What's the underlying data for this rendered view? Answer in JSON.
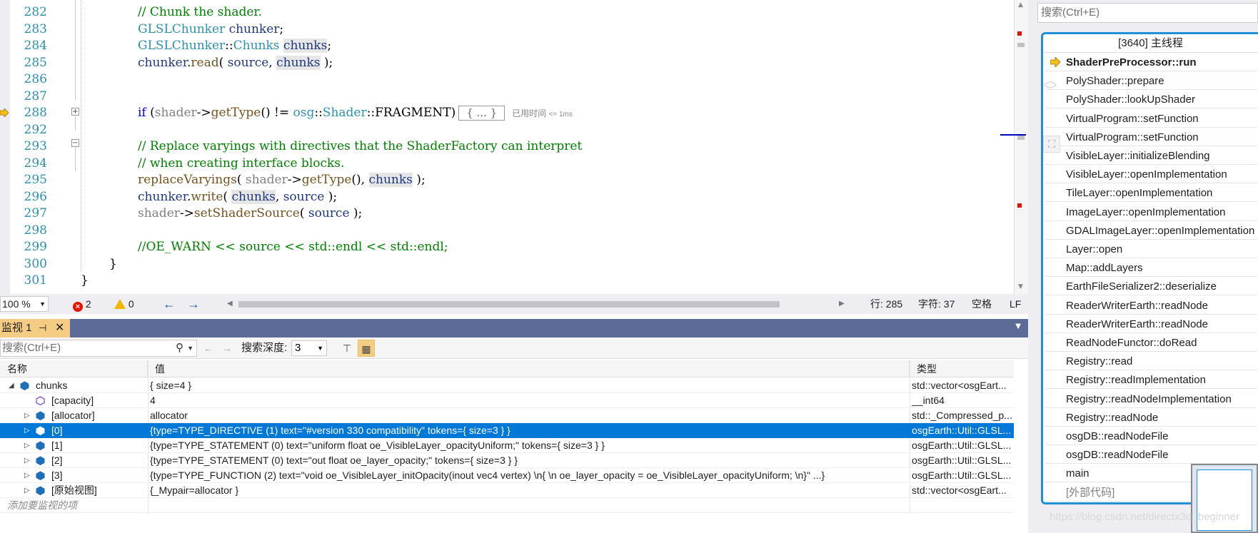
{
  "editor": {
    "lines": [
      {
        "num": "282",
        "html": "<span class=\"cm\">// Chunk the shader.</span>"
      },
      {
        "num": "283",
        "html": "<span class=\"ty\">GLSLChunker</span> <span class=\"vr\">chunker</span>;"
      },
      {
        "num": "284",
        "html": "<span class=\"ty\">GLSLChunker</span>::<span class=\"ty\">Chunks</span> <span class=\"vr hl\">chunks</span>;"
      },
      {
        "num": "285",
        "html": "<span class=\"vr\">chunker</span>.<span class=\"fn\">read</span>( <span class=\"vr\">source</span>, <span class=\"vr hl\">chunks</span> );"
      },
      {
        "num": "286",
        "html": ""
      },
      {
        "num": "287",
        "html": ""
      },
      {
        "num": "288",
        "html": "<span class=\"kw\">if</span> (<span class=\"gr\">shader</span>-&gt;<span class=\"fn\">getType</span>() != <span class=\"ty\">osg</span>::<span class=\"ty\">Shader</span>::FRAGMENT)<span class=\"collapsed\">{ ... }</span><span class=\"elapsed\">已用时间 <small>&lt;= 1ms</small></span>"
      },
      {
        "num": "292",
        "html": ""
      },
      {
        "num": "293",
        "html": "<span class=\"cm\">// Replace varyings with directives that the ShaderFactory can interpret</span>"
      },
      {
        "num": "294",
        "html": "<span class=\"cm\">// when creating interface blocks.</span>"
      },
      {
        "num": "295",
        "html": "<span class=\"fn\">replaceVaryings</span>( <span class=\"gr\">shader</span>-&gt;<span class=\"fn\">getType</span>(), <span class=\"vr hl\">chunks</span> );"
      },
      {
        "num": "296",
        "html": "<span class=\"vr\">chunker</span>.<span class=\"fn\">write</span>( <span class=\"vr hl\">chunks</span>, <span class=\"vr\">source</span> );"
      },
      {
        "num": "297",
        "html": "<span class=\"gr\">shader</span>-&gt;<span class=\"fn\">setShaderSource</span>( <span class=\"vr\">source</span> );"
      },
      {
        "num": "298",
        "html": ""
      },
      {
        "num": "299",
        "html": "<span class=\"cm\">//OE_WARN &lt;&lt; source &lt;&lt; std::endl &lt;&lt; std::endl;</span>"
      },
      {
        "num": "300",
        "html": "}"
      },
      {
        "num": "301",
        "html": "}"
      }
    ]
  },
  "status": {
    "zoom": "100 %",
    "errors": "2",
    "warnings": "0",
    "line": "行: 285",
    "char": "字符: 37",
    "whitespace": "空格",
    "eol": "LF"
  },
  "watch": {
    "tab_label": "监视 1",
    "search_placeholder": "搜索(Ctrl+E)",
    "depth_label": "搜索深度:",
    "depth_value": "3",
    "columns": {
      "name": "名称",
      "value": "值",
      "type": "类型"
    },
    "rows": [
      {
        "name": "chunks",
        "value": "{ size=4 }",
        "type": "std::vector<osgEart...",
        "indent": 0,
        "expander": "open",
        "icon": "object"
      },
      {
        "name": "[capacity]",
        "value": "4",
        "type": "__int64",
        "indent": 1,
        "expander": "none",
        "icon": "field"
      },
      {
        "name": "[allocator]",
        "value": "allocator",
        "type": "std::_Compressed_p...",
        "indent": 1,
        "expander": "closed",
        "icon": "object"
      },
      {
        "name": "[0]",
        "value": "{type=TYPE_DIRECTIVE (1) text=\"#version 330 compatibility\" tokens={ size=3 } }",
        "type": "osgEarth::Util::GLSL...",
        "indent": 1,
        "expander": "closed",
        "icon": "object",
        "selected": true
      },
      {
        "name": "[1]",
        "value": "{type=TYPE_STATEMENT (0) text=\"uniform float oe_VisibleLayer_opacityUniform;\" tokens={ size=3 } }",
        "type": "osgEarth::Util::GLSL...",
        "indent": 1,
        "expander": "closed",
        "icon": "object"
      },
      {
        "name": "[2]",
        "value": "{type=TYPE_STATEMENT (0) text=\"out float oe_layer_opacity;\" tokens={ size=3 } }",
        "type": "osgEarth::Util::GLSL...",
        "indent": 1,
        "expander": "closed",
        "icon": "object"
      },
      {
        "name": "[3]",
        "value": "{type=TYPE_FUNCTION (2) text=\"void oe_VisibleLayer_initOpacity(inout vec4 vertex) \\n{ \\n    oe_layer_opacity = oe_VisibleLayer_opacityUniform; \\n}\" ...}",
        "type": "osgEarth::Util::GLSL...",
        "indent": 1,
        "expander": "closed",
        "icon": "object"
      },
      {
        "name": "[原始视图]",
        "value": "{_Mypair=allocator }",
        "type": "std::vector<osgEart...",
        "indent": 1,
        "expander": "closed",
        "icon": "object"
      }
    ],
    "add_placeholder": "添加要监视的项"
  },
  "callstack": {
    "search_placeholder": "搜索(Ctrl+E)",
    "thread_title": "[3640] 主线程",
    "frames": [
      "ShaderPreProcessor::run",
      "PolyShader::prepare",
      "PolyShader::lookUpShader",
      "VirtualProgram::setFunction",
      "VirtualProgram::setFunction",
      "VisibleLayer::initializeBlending",
      "VisibleLayer::openImplementation",
      "TileLayer::openImplementation",
      "ImageLayer::openImplementation",
      "GDALImageLayer::openImplementation",
      "Layer::open",
      "Map::addLayers",
      "EarthFileSerializer2::deserialize",
      "ReaderWriterEarth::readNode",
      "ReaderWriterEarth::readNode",
      "ReadNodeFunctor::doRead",
      "Registry::read",
      "Registry::readImplementation",
      "Registry::readNodeImplementation",
      "Registry::readNode",
      "osgDB::readNodeFile",
      "osgDB::readNodeFile",
      "main",
      "[外部代码]"
    ]
  },
  "watermark": "https://blog.csdn.net/directx3d_beginner",
  "colors": {
    "accent": "#0078d7",
    "tab_active": "#f5cc84",
    "title_bar": "#5d6b99",
    "error": "#e51400",
    "warning": "#f2b705"
  }
}
